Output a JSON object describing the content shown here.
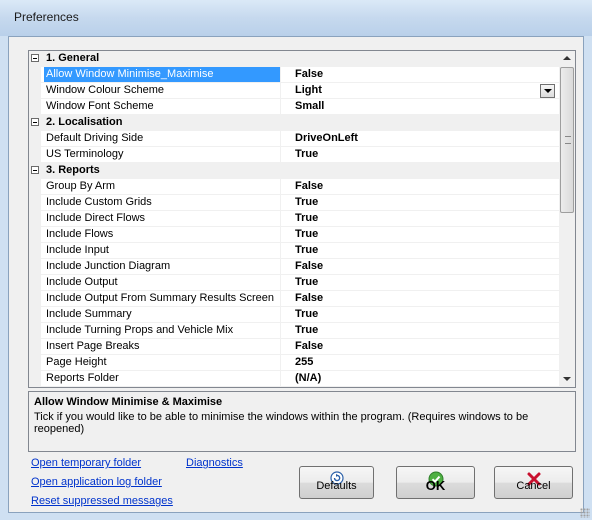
{
  "window": {
    "title": "Preferences"
  },
  "categories": [
    {
      "label": "1. General",
      "items": [
        {
          "name": "Allow Window Minimise_Maximise",
          "value": "False"
        },
        {
          "name": "Window Colour Scheme",
          "value": "Light"
        },
        {
          "name": "Window Font Scheme",
          "value": "Small"
        }
      ]
    },
    {
      "label": "2. Localisation",
      "items": [
        {
          "name": "Default Driving Side",
          "value": "DriveOnLeft"
        },
        {
          "name": "US Terminology",
          "value": "True"
        }
      ]
    },
    {
      "label": "3. Reports",
      "items": [
        {
          "name": "Group By Arm",
          "value": "False"
        },
        {
          "name": "Include Custom Grids",
          "value": "True"
        },
        {
          "name": "Include Direct Flows",
          "value": "True"
        },
        {
          "name": "Include Flows",
          "value": "True"
        },
        {
          "name": "Include Input",
          "value": "True"
        },
        {
          "name": "Include Junction Diagram",
          "value": "False"
        },
        {
          "name": "Include Output",
          "value": "True"
        },
        {
          "name": "Include Output From Summary Results Screen",
          "value": "False"
        },
        {
          "name": "Include Summary",
          "value": "True"
        },
        {
          "name": "Include Turning Props and Vehicle Mix",
          "value": "True"
        },
        {
          "name": "Insert Page Breaks",
          "value": "False"
        },
        {
          "name": "Page Height",
          "value": "255"
        },
        {
          "name": "Reports Folder",
          "value": "(N/A)"
        }
      ]
    }
  ],
  "description": {
    "title": "Allow Window Minimise & Maximise",
    "text": "Tick if you would like to be able to minimise the windows within the program. (Requires windows to be reopened)"
  },
  "links": {
    "open_temp": "Open temporary folder",
    "diagnostics": "Diagnostics",
    "open_log": "Open application log folder",
    "reset": "Reset suppressed messages"
  },
  "buttons": {
    "defaults": "Defaults",
    "ok": "OK",
    "cancel": "Cancel"
  }
}
